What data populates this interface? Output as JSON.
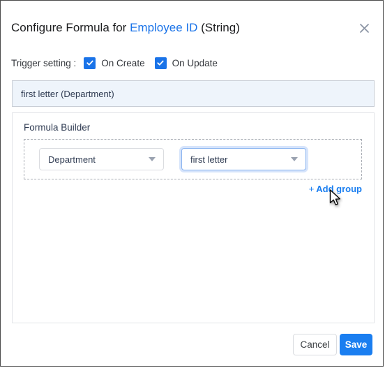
{
  "dialog": {
    "title_prefix": "Configure Formula for ",
    "field_name": "Employee ID",
    "title_suffix": " (String)",
    "close_icon": "close-icon"
  },
  "trigger": {
    "label": "Trigger setting :",
    "options": [
      {
        "label": "On Create",
        "checked": true
      },
      {
        "label": "On Update",
        "checked": true
      }
    ]
  },
  "preview": {
    "text": "first letter (Department)"
  },
  "builder": {
    "title": "Formula Builder",
    "groups": [
      {
        "field_select": {
          "value": "Department",
          "focused": false
        },
        "function_select": {
          "value": "first letter",
          "focused": true
        }
      }
    ],
    "add_group": {
      "plus": "+",
      "label": "Add group"
    }
  },
  "footer": {
    "cancel_label": "Cancel",
    "save_label": "Save"
  },
  "colors": {
    "accent_blue": "#1a7ef0",
    "link_blue": "#1a73e8",
    "preview_bg": "#eef4fb",
    "text_dark": "#2f3b52"
  }
}
